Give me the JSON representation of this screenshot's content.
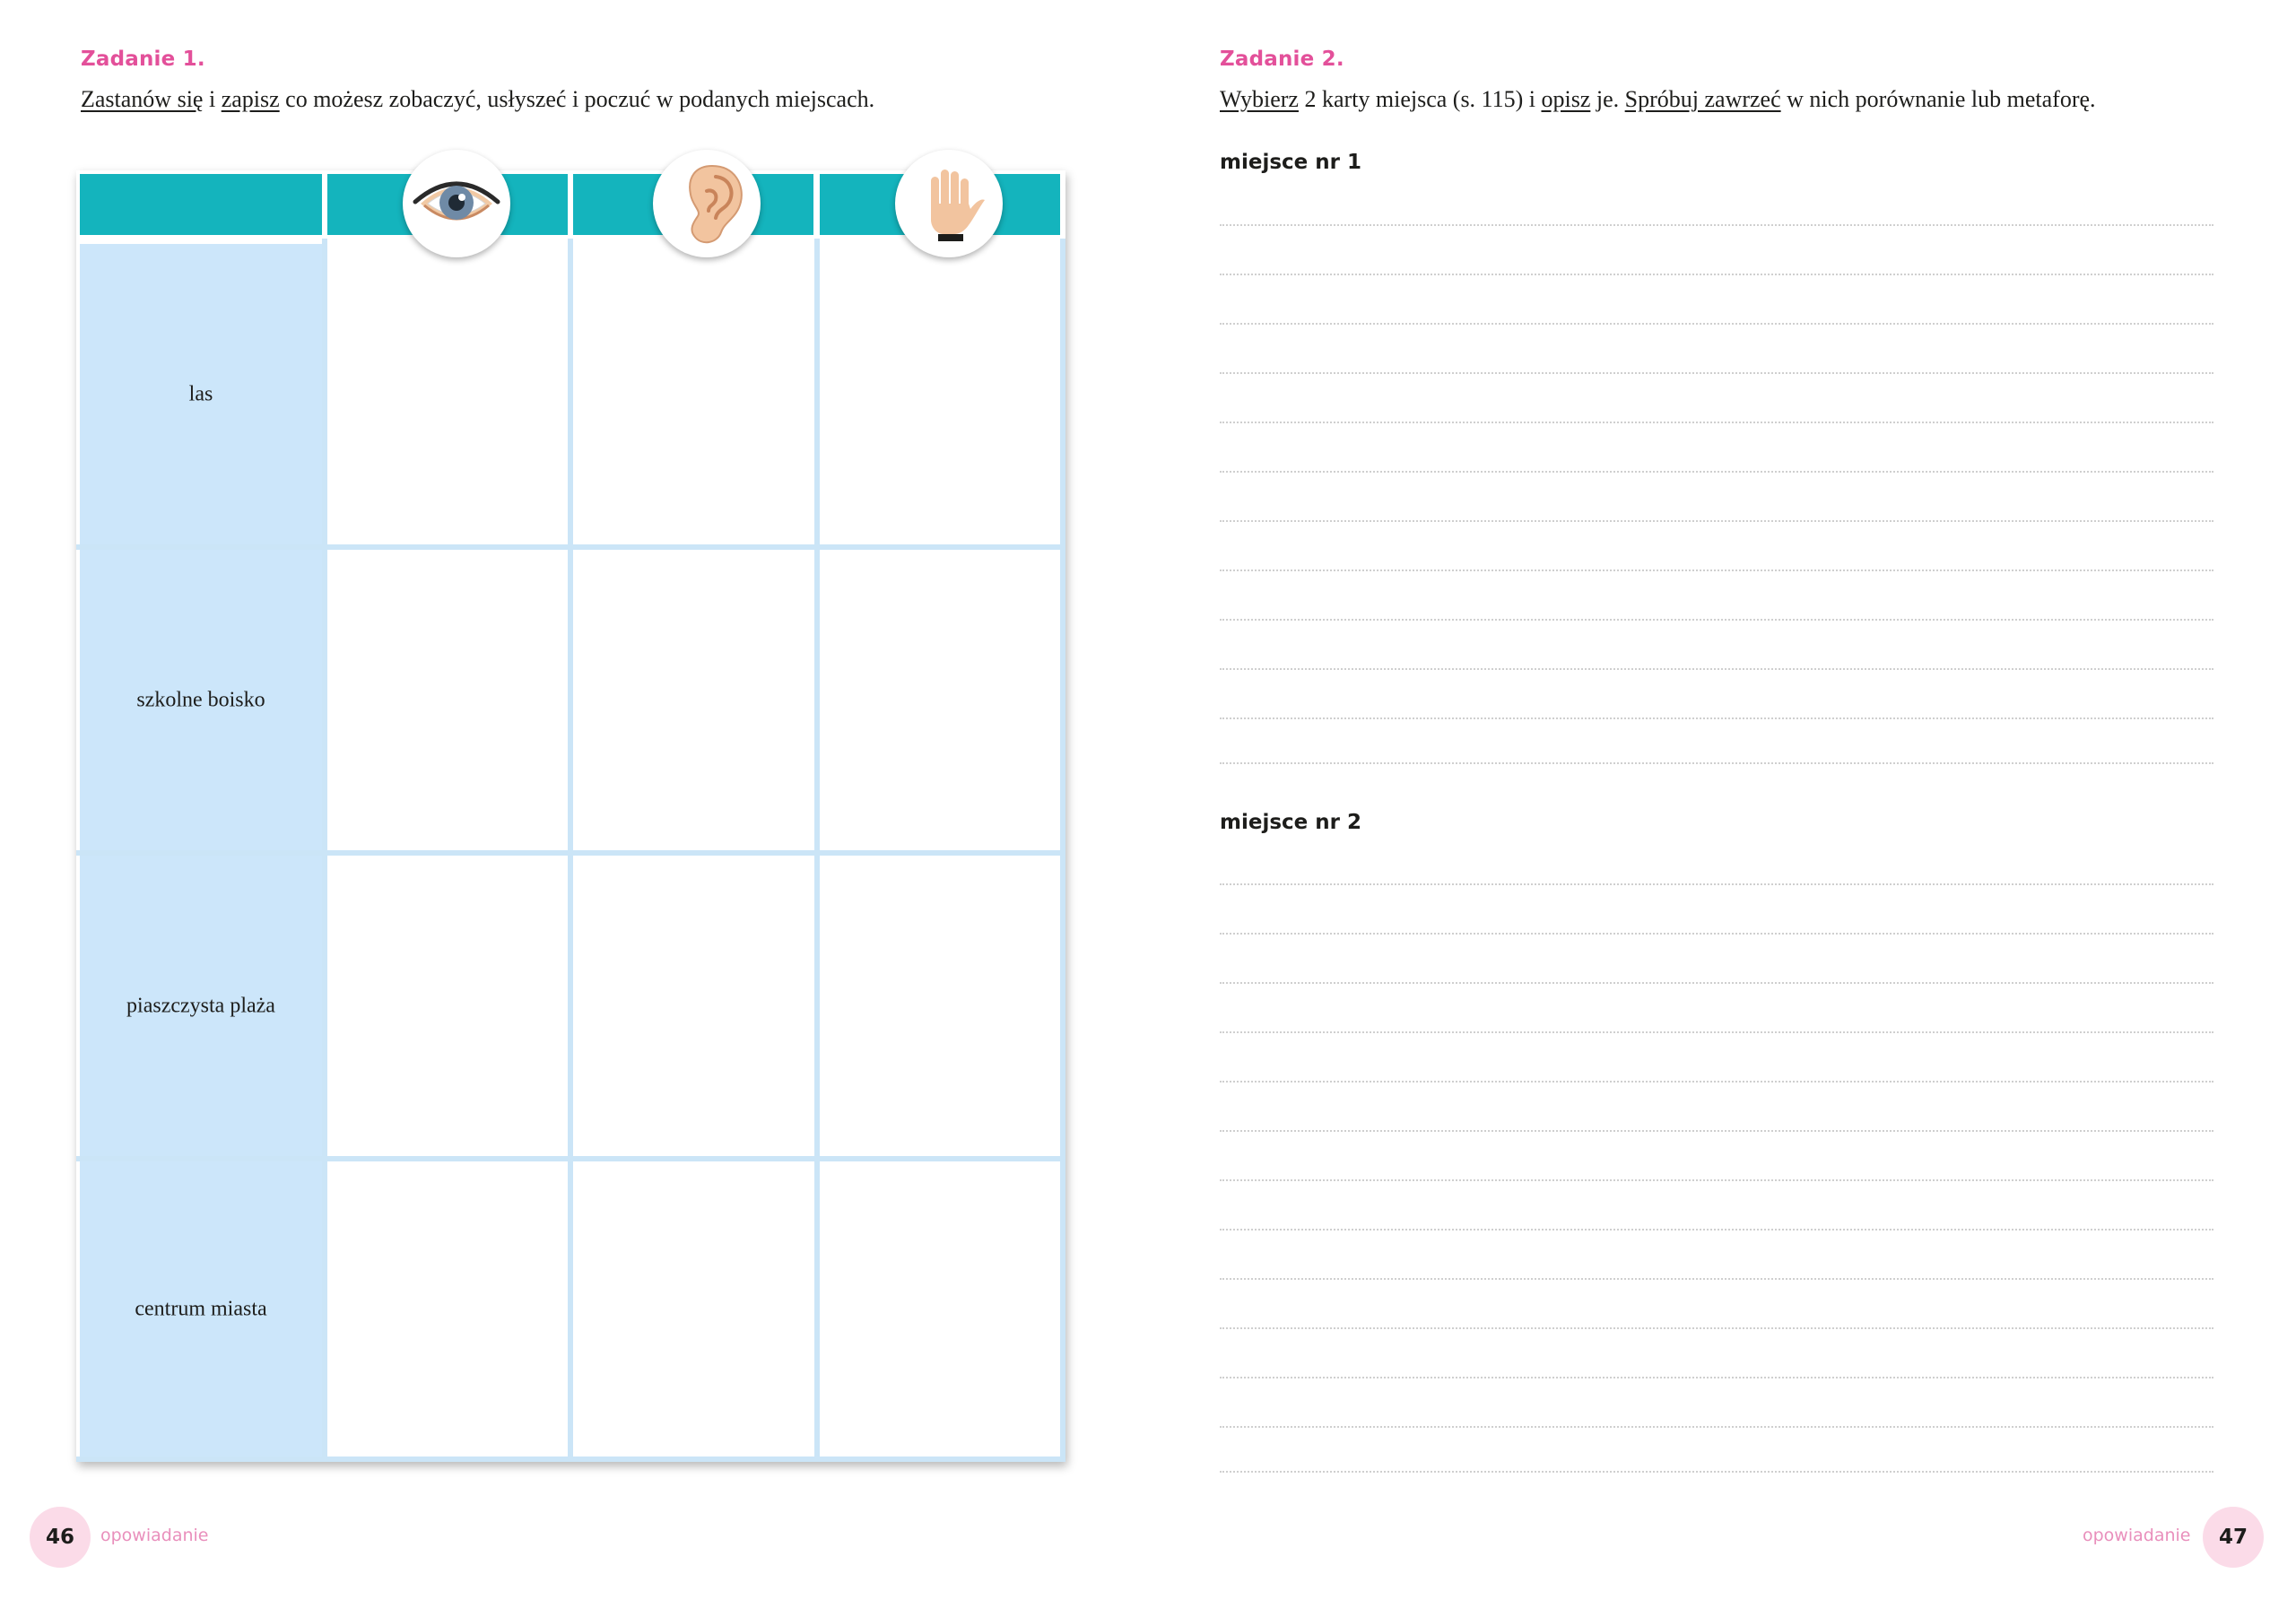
{
  "left_page": {
    "task_title": "Zadanie 1.",
    "instruction": {
      "part1": "Zastanów się",
      "part2": " i ",
      "part3": "zapisz",
      "part4": " co możesz zobaczyć, usłyszeć i poczuć w podanych miejscach."
    },
    "table": {
      "header_icons": [
        "eye-icon",
        "ear-icon",
        "hand-icon"
      ],
      "rows": [
        "las",
        "szkolne boisko",
        "piaszczysta plaża",
        "centrum miasta"
      ]
    },
    "page_number": "46",
    "footer_label": "opowiadanie"
  },
  "right_page": {
    "task_title": "Zadanie 2.",
    "instruction": {
      "part1": "Wybierz",
      "part2": " 2 karty miejsca (s. 115) i ",
      "part3": "opisz",
      "part4": " je. ",
      "part5": "Spróbuj zawrzeć",
      "part6": " w nich porównanie lub metaforę."
    },
    "place1_label": "miejsce nr 1",
    "place2_label": "miejsce nr 2",
    "page_number": "47",
    "footer_label": "opowiadanie"
  },
  "colors": {
    "accent_pink": "#e3509a",
    "header_teal": "#14b4bd",
    "row_blue": "#cce6fa",
    "badge_pink": "#fbdbe8"
  }
}
